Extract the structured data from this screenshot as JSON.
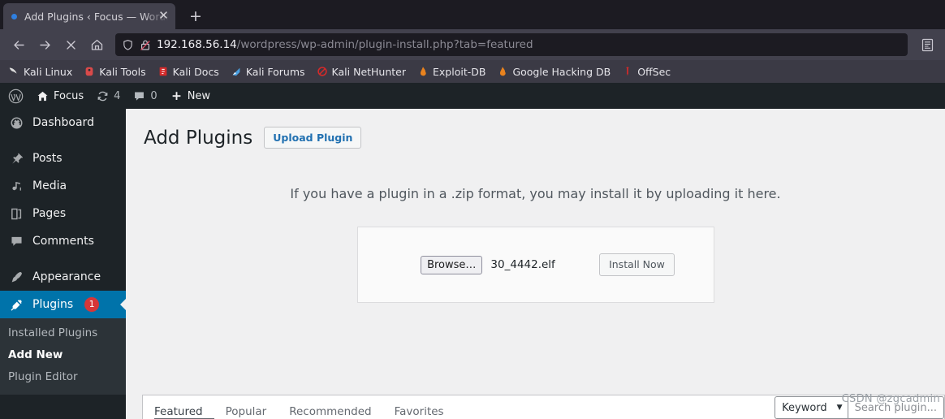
{
  "browser": {
    "tab": {
      "title": "Add Plugins ‹ Focus — WordPress",
      "close_label": "✕"
    },
    "new_tab_label": "+",
    "nav": {
      "back": "back-arrow",
      "forward": "forward-arrow",
      "stop": "stop-x",
      "home": "home"
    },
    "url": {
      "host": "192.168.56.14",
      "path": "/wordpress/wp-admin/plugin-install.php?tab=featured"
    },
    "bookmarks": [
      {
        "label": "Kali Linux",
        "icon": "kali-dragon-icon",
        "color": "#dcdcdc"
      },
      {
        "label": "Kali Tools",
        "icon": "kali-tools-icon",
        "color": "#d94a4a"
      },
      {
        "label": "Kali Docs",
        "icon": "kali-docs-icon",
        "color": "#d42a2a"
      },
      {
        "label": "Kali Forums",
        "icon": "kali-forums-icon",
        "color": "#4a9fe0"
      },
      {
        "label": "Kali NetHunter",
        "icon": "kali-nethunter-icon",
        "color": "#d42a2a"
      },
      {
        "label": "Exploit-DB",
        "icon": "exploit-db-icon",
        "color": "#e8821e"
      },
      {
        "label": "Google Hacking DB",
        "icon": "google-hacking-db-icon",
        "color": "#e8821e"
      },
      {
        "label": "OffSec",
        "icon": "offsec-icon",
        "color": "#d42a2a"
      }
    ]
  },
  "adminbar": {
    "logo": "wordpress-logo-icon",
    "site_name": "Focus",
    "updates_count": "4",
    "comments_count": "0",
    "new_label": "New"
  },
  "sidebar": {
    "items": [
      {
        "label": "Dashboard",
        "icon": "dashboard-icon",
        "current": false,
        "badge": ""
      },
      {
        "label": "Posts",
        "icon": "pin-icon",
        "current": false,
        "badge": ""
      },
      {
        "label": "Media",
        "icon": "media-icon",
        "current": false,
        "badge": ""
      },
      {
        "label": "Pages",
        "icon": "pages-icon",
        "current": false,
        "badge": ""
      },
      {
        "label": "Comments",
        "icon": "comments-icon",
        "current": false,
        "badge": ""
      },
      {
        "label": "Appearance",
        "icon": "appearance-brush-icon",
        "current": false,
        "badge": ""
      },
      {
        "label": "Plugins",
        "icon": "plugins-plug-icon",
        "current": true,
        "badge": "1"
      }
    ],
    "submenu": [
      {
        "label": "Installed Plugins",
        "current": false
      },
      {
        "label": "Add New",
        "current": true
      },
      {
        "label": "Plugin Editor",
        "current": false
      }
    ]
  },
  "main": {
    "title": "Add Plugins",
    "upload_button": "Upload Plugin",
    "upload_intro": "If you have a plugin in a .zip format, you may install it by uploading it here.",
    "browse_button": "Browse…",
    "file_name": "30_4442.elf",
    "install_button": "Install Now",
    "tabs": [
      {
        "label": "Featured",
        "active": true
      },
      {
        "label": "Popular",
        "active": false
      },
      {
        "label": "Recommended",
        "active": false
      },
      {
        "label": "Favorites",
        "active": false
      }
    ],
    "search": {
      "select_value": "Keyword",
      "chevron": "▼",
      "placeholder": "Search plugin..."
    }
  },
  "watermark": "CSDN @zgcadmin",
  "colors": {
    "wp_blue": "#0073aa",
    "wp_dark": "#1d2327",
    "wp_submenu": "#2c3338",
    "badge_red": "#d63638",
    "link_blue": "#2271b1",
    "chrome_dark": "#1c1b22",
    "chrome_mid": "#42414d"
  }
}
